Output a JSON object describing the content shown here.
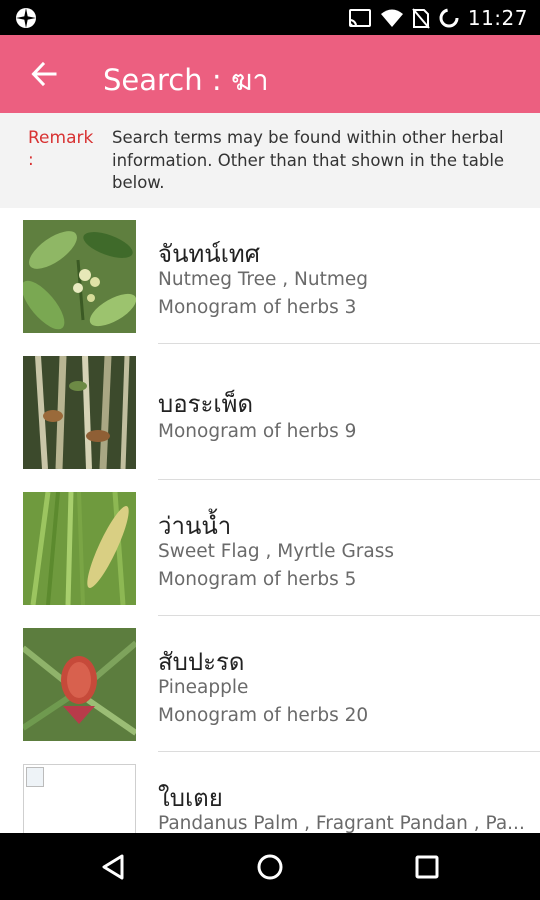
{
  "status_bar": {
    "time": "11:27",
    "icons": [
      "app-notification-icon",
      "cast-icon",
      "wifi-icon",
      "no-sim-icon",
      "battery-charging-icon"
    ]
  },
  "app_bar": {
    "back_icon": "arrow-left-icon",
    "title": "Search : ฆา"
  },
  "remark": {
    "label": "Remark :",
    "text": "Search terms may be found within other herbal information. Other than that shown in the table below."
  },
  "results": [
    {
      "thai_name": "จันทน์เทศ",
      "english": "Nutmeg Tree , Nutmeg",
      "monogram": "Monogram of herbs 3",
      "image": "nutmeg-photo"
    },
    {
      "thai_name": "บอระเพ็ด",
      "english": "",
      "monogram": "Monogram of herbs 9",
      "image": "borapet-photo"
    },
    {
      "thai_name": "ว่านน้ำ",
      "english": "Sweet Flag , Myrtle Grass",
      "monogram": "Monogram of herbs 5",
      "image": "sweet-flag-photo"
    },
    {
      "thai_name": "สับปะรด",
      "english": "Pineapple",
      "monogram": "Monogram of herbs 20",
      "image": "pineapple-photo"
    },
    {
      "thai_name": "ใบเตย",
      "english": "Pandanus Palm , Fragrant Pandan , Pa...",
      "monogram": "",
      "image": "broken-image"
    }
  ],
  "nav_bar": {
    "back_icon": "nav-back-triangle-icon",
    "home_icon": "nav-home-circle-icon",
    "recents_icon": "nav-recents-square-icon"
  },
  "colors": {
    "accent": "#ec5f80",
    "remark_label": "#d83232"
  }
}
